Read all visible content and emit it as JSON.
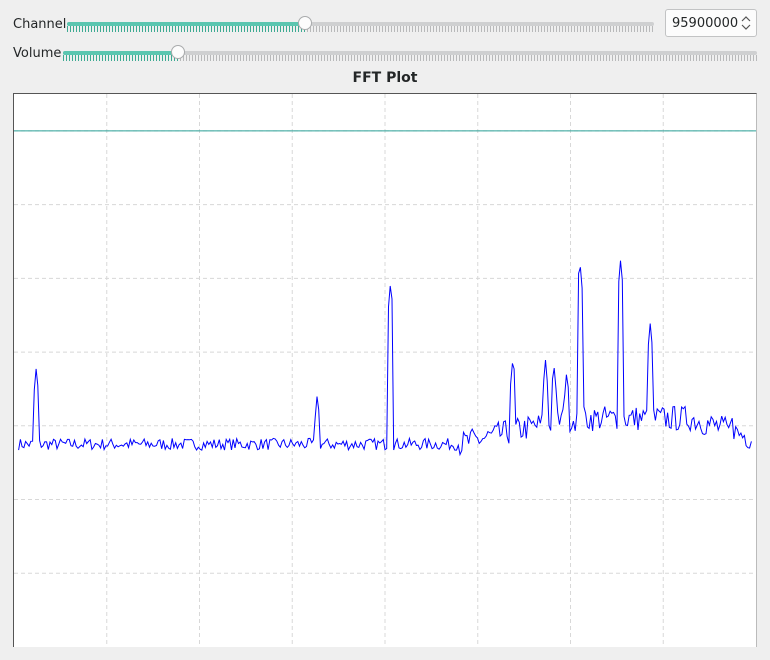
{
  "controls": {
    "channel": {
      "label": "Channel",
      "fraction": 0.405,
      "value": "95900000"
    },
    "volume": {
      "label": "Volume",
      "fraction": 0.165
    }
  },
  "icons": {
    "spin_arrows": "up-down-chevron-icon"
  },
  "colors": {
    "accent": "#5cc6b0",
    "trace": "#0000ff",
    "reference_line": "#2aa198",
    "grid": "#d8d8d8"
  },
  "chart_data": {
    "type": "line",
    "title": "FFT Plot",
    "xlabel": "",
    "ylabel": "",
    "grid": true,
    "xlim": [
      0,
      8
    ],
    "ylim": [
      0,
      7.5
    ],
    "reference_line": {
      "y": 7.0
    },
    "series": [
      {
        "baseline_y": 2.75,
        "noise_amplitude": 0.08,
        "points": 420,
        "peaks": [
          {
            "x": 0.24,
            "y": 3.8
          },
          {
            "x": 3.27,
            "y": 3.45
          },
          {
            "x": 4.06,
            "y": 4.95
          },
          {
            "x": 5.38,
            "y": 3.95
          },
          {
            "x": 5.73,
            "y": 3.9
          },
          {
            "x": 5.82,
            "y": 3.85
          },
          {
            "x": 5.96,
            "y": 3.75
          },
          {
            "x": 6.1,
            "y": 5.25
          },
          {
            "x": 6.54,
            "y": 5.25
          },
          {
            "x": 6.86,
            "y": 4.4
          },
          {
            "x": 7.74,
            "y": 3.15
          }
        ]
      }
    ]
  }
}
